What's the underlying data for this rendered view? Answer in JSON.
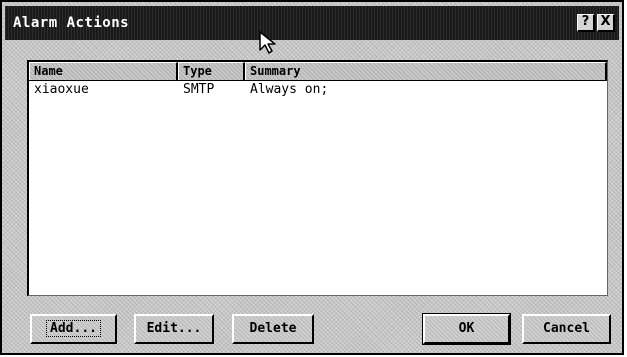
{
  "window": {
    "title": "Alarm Actions",
    "help_button": "?",
    "close_button": "X"
  },
  "list": {
    "columns": [
      "Name",
      "Type",
      "Summary"
    ],
    "rows": [
      {
        "name": "xiaoxue",
        "type": "SMTP",
        "summary": "Always on;"
      }
    ]
  },
  "buttons": {
    "add": "Add...",
    "edit": "Edit...",
    "delete": "Delete",
    "ok": "OK",
    "cancel": "Cancel"
  },
  "colors": {
    "titlebar": "#1a1a1a",
    "face": "#c8c8c8",
    "list_bg": "#ffffff"
  },
  "icons": {
    "cursor": "mouse-pointer-icon"
  }
}
